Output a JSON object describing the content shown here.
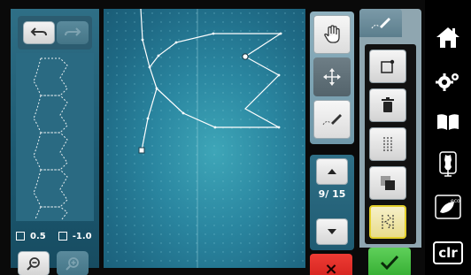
{
  "left_panel": {
    "readout_width": "0.5",
    "readout_height": "-1.0"
  },
  "page_nav": {
    "page_label": "9/ 15"
  },
  "cancel": {
    "label": "×"
  },
  "side_nav": {
    "items": [
      "home-icon",
      "settings-icon",
      "manual-icon",
      "mannequin-icon",
      "eco-icon",
      "clr"
    ],
    "clr_label": "clr",
    "eco_label": "eco"
  },
  "colors": {
    "accent_yellow": "#e2cf2a",
    "cancel_red": "#e0302a",
    "ok_green": "#44bd40",
    "canvas_teal": "#2a86a0"
  }
}
